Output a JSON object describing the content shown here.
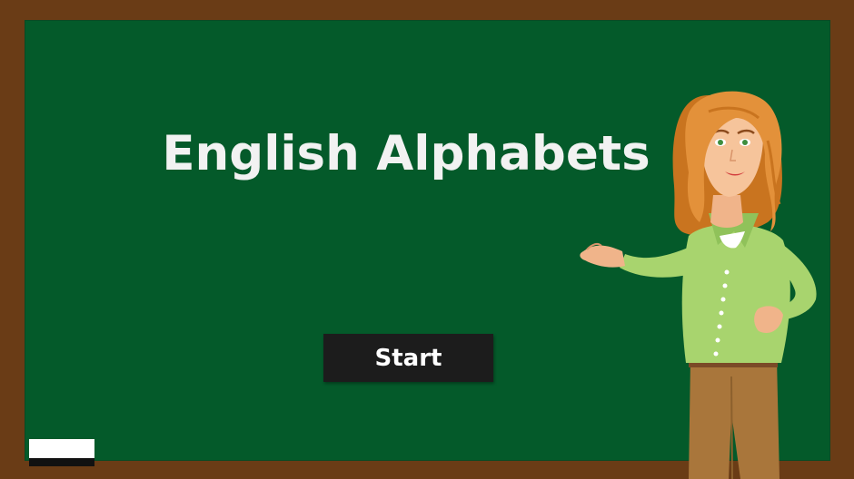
{
  "page": {
    "title": "English Alphabets",
    "start_label": "Start"
  },
  "colors": {
    "board": "#045a2a",
    "frame": "#6a3c16",
    "button": "#1c1c1c",
    "title_text": "#f2f2f2"
  },
  "icons": {
    "eraser": "chalkboard-eraser",
    "teacher": "teacher-illustration"
  }
}
